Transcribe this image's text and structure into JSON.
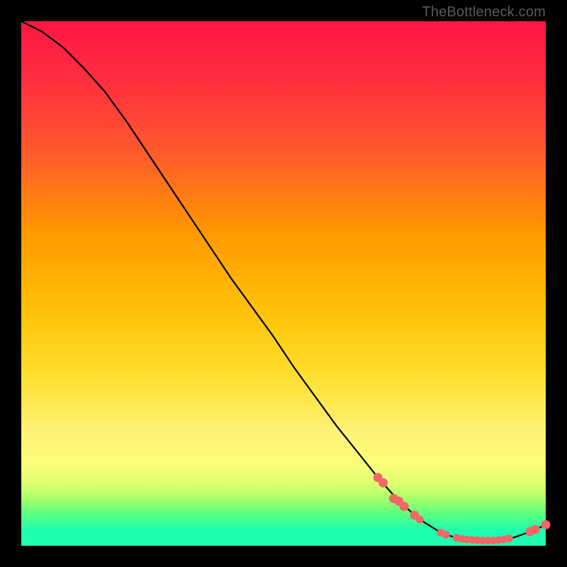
{
  "watermark": "TheBottleneck.com",
  "chart_data": {
    "type": "line",
    "title": "",
    "xlabel": "",
    "ylabel": "",
    "xlim": [
      0,
      100
    ],
    "ylim": [
      0,
      100
    ],
    "series": [
      {
        "name": "curve",
        "x": [
          0,
          4,
          8,
          12,
          16,
          20,
          24,
          28,
          32,
          36,
          40,
          44,
          48,
          52,
          56,
          60,
          64,
          68,
          72,
          76,
          80,
          82,
          84,
          86,
          88,
          90,
          92,
          94,
          96,
          98,
          100
        ],
        "values": [
          100,
          98,
          95,
          91,
          86.5,
          81,
          75,
          69,
          63,
          57,
          51,
          45.5,
          40,
          34,
          28.5,
          23,
          18,
          13,
          8.5,
          5,
          2.5,
          1.8,
          1.3,
          1.1,
          1.0,
          1.0,
          1.2,
          1.6,
          2.3,
          3.1,
          4.0
        ]
      }
    ],
    "markers": [
      {
        "x": 68,
        "y": 13
      },
      {
        "x": 69,
        "y": 12
      },
      {
        "x": 71,
        "y": 9
      },
      {
        "x": 72,
        "y": 8.5
      },
      {
        "x": 73,
        "y": 7.5
      },
      {
        "x": 75,
        "y": 5.8
      },
      {
        "x": 76,
        "y": 5.0
      },
      {
        "x": 80,
        "y": 2.5
      },
      {
        "x": 81,
        "y": 2.1
      },
      {
        "x": 83,
        "y": 1.5
      },
      {
        "x": 84,
        "y": 1.3
      },
      {
        "x": 85,
        "y": 1.2
      },
      {
        "x": 86,
        "y": 1.1
      },
      {
        "x": 87,
        "y": 1.05
      },
      {
        "x": 88,
        "y": 1.0
      },
      {
        "x": 89,
        "y": 1.0
      },
      {
        "x": 90,
        "y": 1.0
      },
      {
        "x": 91,
        "y": 1.1
      },
      {
        "x": 92,
        "y": 1.2
      },
      {
        "x": 93,
        "y": 1.4
      },
      {
        "x": 97,
        "y": 2.7
      },
      {
        "x": 98,
        "y": 3.1
      },
      {
        "x": 100,
        "y": 4.0
      }
    ],
    "marker_style": {
      "color": "#f06868",
      "radius_small": 5.5,
      "radius_large": 6.5
    },
    "line_color": "#000000"
  }
}
